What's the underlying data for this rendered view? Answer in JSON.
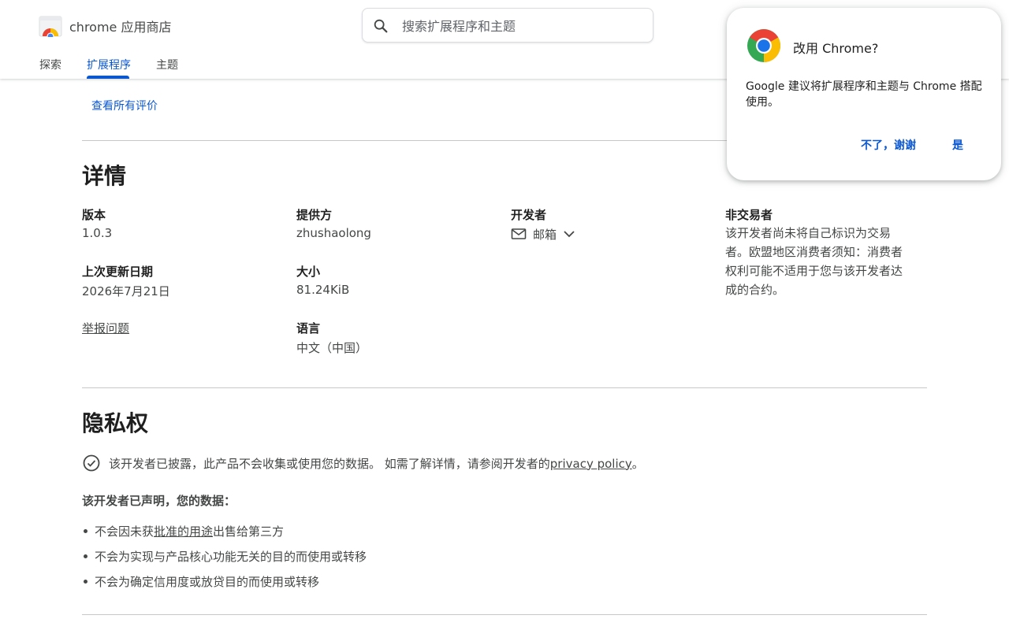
{
  "header": {
    "brand": "chrome 应用商店",
    "search_placeholder": "搜索扩展程序和主题",
    "tabs": [
      {
        "label": "探索",
        "active": false
      },
      {
        "label": "扩展程序",
        "active": true
      },
      {
        "label": "主题",
        "active": false
      }
    ]
  },
  "reviews": {
    "see_all_label": "查看所有评价"
  },
  "details": {
    "title": "详情",
    "version_label": "版本",
    "version_value": "1.0.3",
    "updated_label": "上次更新日期",
    "updated_value": "2026年7月21日",
    "report_label": "举报问题",
    "provider_label": "提供方",
    "provider_value": "zhushaolong",
    "size_label": "大小",
    "size_value": "81.24KiB",
    "language_label": "语言",
    "language_value": "中文（中国）",
    "developer_label": "开发者",
    "developer_email": "邮箱",
    "nontrader_label": "非交易者",
    "nontrader_text": "该开发者尚未将自己标识为交易者。欧盟地区消费者须知：消费者权利可能不适用于您与该开发者达成的合约。"
  },
  "privacy": {
    "title": "隐私权",
    "disclosure_text": "该开发者已披露，此产品不会收集或使用您的数据。 如需了解详情，请参阅开发者的",
    "policy_link": "privacy policy",
    "period": "。",
    "declared_label": "该开发者已声明，您的数据：",
    "bullet1_pre": "不会因未获",
    "bullet1_link": "批准的用途",
    "bullet1_post": "出售给第三方",
    "bullet2": "不会为实现与产品核心功能无关的目的而使用或转移",
    "bullet3": "不会为确定信用度或放贷目的而使用或转移"
  },
  "popup": {
    "title": "改用 Chrome?",
    "body": "Google 建议将扩展程序和主题与 Chrome 搭配使用。",
    "no_label": "不了，谢谢",
    "yes_label": "是"
  },
  "colors": {
    "accent": "#0b57d0",
    "text": "#1f1f1f",
    "secondary_text": "#444746",
    "divider": "#c7c7c7"
  }
}
